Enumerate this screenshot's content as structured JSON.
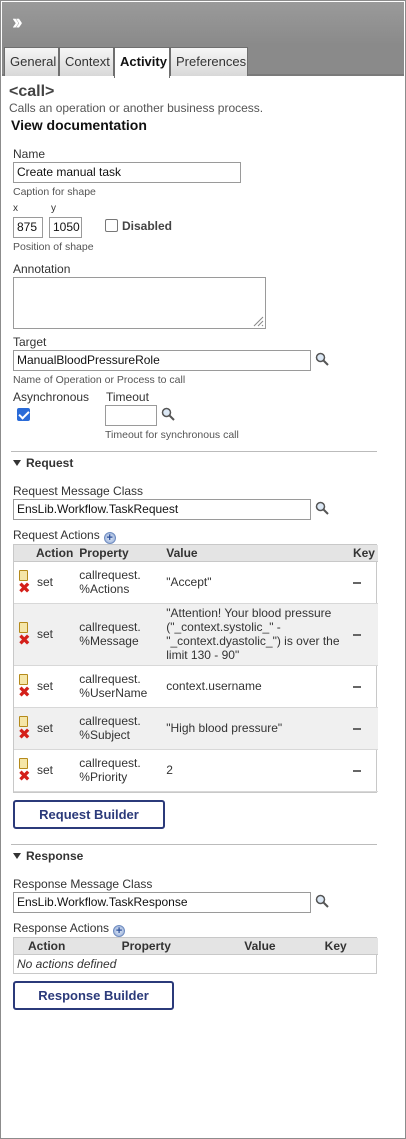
{
  "tabs": [
    {
      "label": "General"
    },
    {
      "label": "Context"
    },
    {
      "label": "Activity",
      "active": true
    },
    {
      "label": "Preferences"
    }
  ],
  "element": {
    "title": "<call>",
    "description": "Calls an operation or another business process.",
    "doc_link": "View documentation"
  },
  "name": {
    "label": "Name",
    "value": "Create manual task",
    "hint": "Caption for shape"
  },
  "position": {
    "x_label": "x",
    "y_label": "y",
    "x_value": "875",
    "y_value": "1050",
    "hint": "Position of shape"
  },
  "disabled": {
    "label": "Disabled",
    "checked": false
  },
  "annotation": {
    "label": "Annotation",
    "value": ""
  },
  "target": {
    "label": "Target",
    "value": "ManualBloodPressureRole",
    "hint": "Name of Operation or Process to call"
  },
  "asynchronous": {
    "label": "Asynchronous",
    "checked": true
  },
  "timeout": {
    "label": "Timeout",
    "value": "",
    "hint": "Timeout for synchronous call"
  },
  "request": {
    "section_label": "Request",
    "class_label": "Request Message Class",
    "class_value": "EnsLib.Workflow.TaskRequest",
    "actions_label": "Request Actions",
    "columns": [
      "Action",
      "Property",
      "Value",
      "Key"
    ],
    "rows": [
      {
        "action": "set",
        "property": "callrequest.\n%Actions",
        "value": "\"Accept\""
      },
      {
        "action": "set",
        "property": "callrequest.\n%Message",
        "value": "\"Attention! Your blood pressure (\"_context.systolic_\" - \"_context.dyastolic_\") is over the limit 130 - 90\""
      },
      {
        "action": "set",
        "property": "callrequest.\n%UserName",
        "value": "context.username"
      },
      {
        "action": "set",
        "property": "callrequest.\n%Subject",
        "value": "\"High blood pressure\""
      },
      {
        "action": "set",
        "property": "callrequest.\n%Priority",
        "value": "2"
      }
    ],
    "builder_label": "Request Builder"
  },
  "response": {
    "section_label": "Response",
    "class_label": "Response Message Class",
    "class_value": "EnsLib.Workflow.TaskResponse",
    "actions_label": "Response Actions",
    "columns": [
      "Action",
      "Property",
      "Value",
      "Key"
    ],
    "empty_text": "No actions defined",
    "builder_label": "Response Builder"
  },
  "icons": {
    "expand": "double-chevron-right-icon",
    "search": "magnifier-icon",
    "add": "plus-circle-icon",
    "paste": "clipboard-icon",
    "delete": "red-x-icon"
  },
  "colors": {
    "topbar": "#8a8a8a",
    "button_border": "#2b3a7a",
    "checkbox": "#2a6bd8"
  }
}
